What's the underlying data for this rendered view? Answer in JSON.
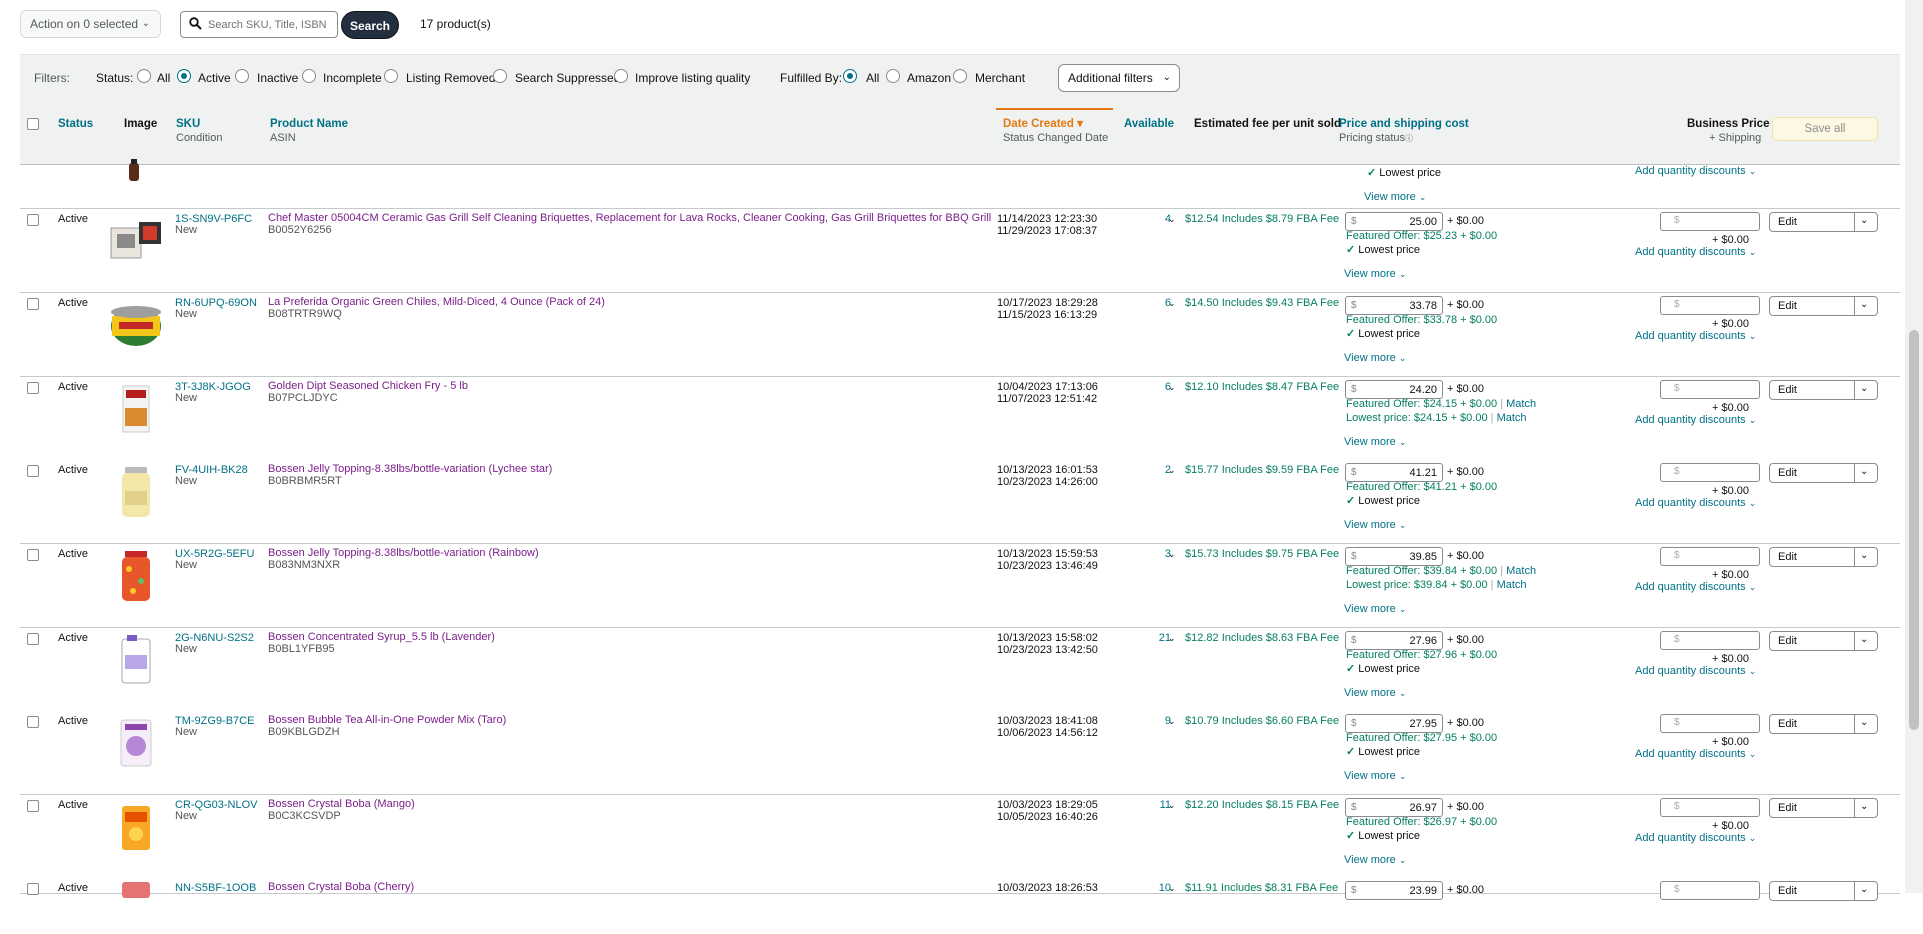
{
  "toolbar": {
    "action_label": "Action on 0 selected",
    "search_placeholder": "Search SKU, Title, ISBN",
    "search_button": "Search",
    "product_count": "17 product(s)"
  },
  "filters": {
    "label": "Filters:",
    "status_label": "Status:",
    "status_options": [
      "All",
      "Active",
      "Inactive",
      "Incomplete",
      "Listing Removed",
      "Search Suppressed",
      "Improve listing quality"
    ],
    "status_selected": "Active",
    "fulfilled_label": "Fulfilled By:",
    "fulfilled_options": [
      "All",
      "Amazon",
      "Merchant"
    ],
    "fulfilled_selected": "All",
    "additional_filters": "Additional filters"
  },
  "table_header": {
    "status": "Status",
    "image": "Image",
    "sku": "SKU",
    "condition": "Condition",
    "product_name": "Product Name",
    "asin": "ASIN",
    "date_created": "Date Created",
    "status_changed": "Status Changed Date",
    "available": "Available",
    "fee": "Estimated fee per unit sold",
    "price": "Price and shipping cost",
    "pricing_status": "Pricing status",
    "business_price": "Business Price",
    "shipping": "+ Shipping",
    "save_all": "Save all"
  },
  "partial_top": {
    "lowest": "Lowest price",
    "view_more": "View more",
    "add_qty": "Add quantity discounts"
  },
  "common": {
    "ship_zero": "+ $0.00",
    "dollar": "$",
    "edit": "Edit",
    "view_more": "View more",
    "add_qty": "Add quantity discounts",
    "lowest": "Lowest price",
    "match": "Match"
  },
  "rows": [
    {
      "status": "Active",
      "sku": "1S-SN9V-P6FC",
      "condition": "New",
      "name": "Chef Master 05004CM Ceramic Gas Grill Self Cleaning Briquettes, Replacement for Lava Rocks, Cleaner Cooking, Gas Grill Briquettes for BBQ Grill",
      "asin": "B0052Y6256",
      "date1": "11/14/2023 12:23:30",
      "date2": "11/29/2023 17:08:37",
      "available": "4",
      "fee_amt": "$12.54",
      "fee_text": "Includes $8.79 FBA Fee",
      "price": "25.00",
      "featured": "Featured Offer: $25.23 + $0.00",
      "lowest_line": "Lowest price",
      "match": false
    },
    {
      "status": "Active",
      "sku": "RN-6UPQ-69ON",
      "condition": "New",
      "name": "La Preferida Organic Green Chiles, Mild-Diced, 4 Ounce (Pack of 24)",
      "asin": "B08TRTR9WQ",
      "date1": "10/17/2023 18:29:28",
      "date2": "11/15/2023 16:13:29",
      "available": "6",
      "fee_amt": "$14.50",
      "fee_text": "Includes $9.43 FBA Fee",
      "price": "33.78",
      "featured": "Featured Offer: $33.78 + $0.00",
      "lowest_line": "Lowest price",
      "match": false
    },
    {
      "status": "Active",
      "sku": "3T-3J8K-JGOG",
      "condition": "New",
      "name": "Golden Dipt Seasoned Chicken Fry - 5 lb",
      "asin": "B07PCLJDYC",
      "date1": "10/04/2023 17:13:06",
      "date2": "11/07/2023 12:51:42",
      "available": "6",
      "fee_amt": "$12.10",
      "fee_text": "Includes $8.47 FBA Fee",
      "price": "24.20",
      "featured": "Featured Offer: $24.15 + $0.00",
      "lowest_line": "Lowest price: $24.15 + $0.00",
      "match": true
    },
    {
      "status": "Active",
      "sku": "FV-4UIH-BK28",
      "condition": "New",
      "name": "Bossen Jelly Topping-8.38lbs/bottle-variation (Lychee star)",
      "asin": "B0BRBMR5RT",
      "date1": "10/13/2023 16:01:53",
      "date2": "10/23/2023 14:26:00",
      "available": "2",
      "fee_amt": "$15.77",
      "fee_text": "Includes $9.59 FBA Fee",
      "price": "41.21",
      "featured": "Featured Offer: $41.21 + $0.00",
      "lowest_line": "Lowest price",
      "match": false
    },
    {
      "status": "Active",
      "sku": "UX-5R2G-5EFU",
      "condition": "New",
      "name": "Bossen Jelly Topping-8.38lbs/bottle-variation (Rainbow)",
      "asin": "B083NM3NXR",
      "date1": "10/13/2023 15:59:53",
      "date2": "10/23/2023 13:46:49",
      "available": "3",
      "fee_amt": "$15.73",
      "fee_text": "Includes $9.75 FBA Fee",
      "price": "39.85",
      "featured": "Featured Offer: $39.84 + $0.00",
      "lowest_line": "Lowest price: $39.84 + $0.00",
      "match": true
    },
    {
      "status": "Active",
      "sku": "2G-N6NU-S2S2",
      "condition": "New",
      "name": "Bossen Concentrated Syrup_5.5 lb (Lavender)",
      "asin": "B0BL1YFB95",
      "date1": "10/13/2023 15:58:02",
      "date2": "10/23/2023 13:42:50",
      "available": "21",
      "fee_amt": "$12.82",
      "fee_text": "Includes $8.63 FBA Fee",
      "price": "27.96",
      "featured": "Featured Offer: $27.96 + $0.00",
      "lowest_line": "Lowest price",
      "match": false
    },
    {
      "status": "Active",
      "sku": "TM-9ZG9-B7CE",
      "condition": "New",
      "name": "Bossen Bubble Tea All-in-One Powder Mix (Taro)",
      "asin": "B09KBLGDZH",
      "date1": "10/03/2023 18:41:08",
      "date2": "10/06/2023 14:56:12",
      "available": "9",
      "fee_amt": "$10.79",
      "fee_text": "Includes $6.60 FBA Fee",
      "price": "27.95",
      "featured": "Featured Offer: $27.95 + $0.00",
      "lowest_line": "Lowest price",
      "match": false
    },
    {
      "status": "Active",
      "sku": "CR-QG03-NLOV",
      "condition": "New",
      "name": "Bossen Crystal Boba (Mango)",
      "asin": "B0C3KCSVDP",
      "date1": "10/03/2023 18:29:05",
      "date2": "10/05/2023 16:40:26",
      "available": "11",
      "fee_amt": "$12.20",
      "fee_text": "Includes $8.15 FBA Fee",
      "price": "26.97",
      "featured": "Featured Offer: $26.97 + $0.00",
      "lowest_line": "Lowest price",
      "match": false
    },
    {
      "status": "Active",
      "sku": "NN-S5BF-1OOB",
      "condition": "",
      "name": "Bossen Crystal Boba (Cherry)",
      "asin": "",
      "date1": "10/03/2023 18:26:53",
      "date2": "",
      "available": "10",
      "fee_amt": "$11.91",
      "fee_text": "Includes $8.31 FBA Fee",
      "price": "23.99",
      "featured": "",
      "lowest_line": "",
      "match": false
    }
  ]
}
